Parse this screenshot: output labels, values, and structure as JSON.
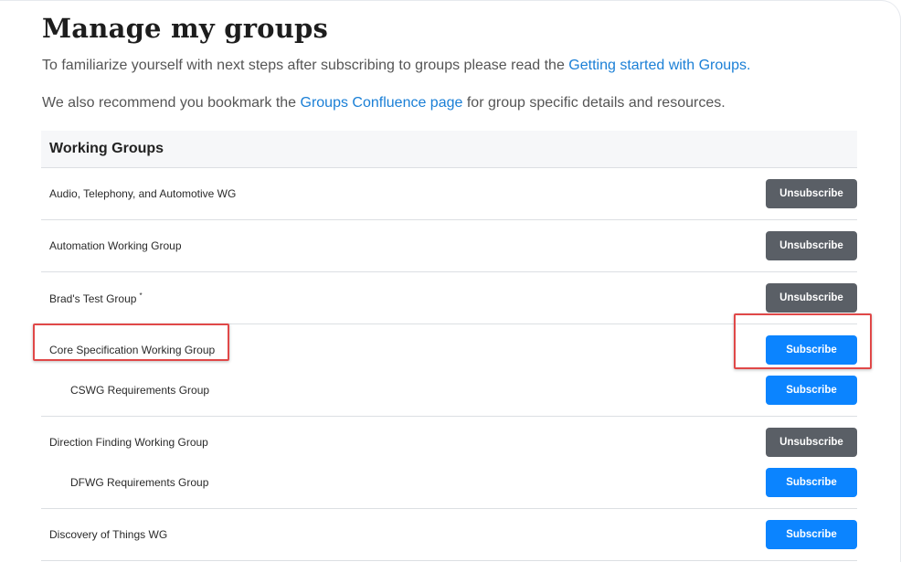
{
  "page": {
    "title": "Manage my groups",
    "intro1": {
      "text": "To familiarize yourself with next steps after subscribing to groups please read the ",
      "link": "Getting started with Groups."
    },
    "intro2": {
      "text_before": "We also recommend you bookmark the ",
      "link": "Groups Confluence page",
      "text_after": " for group specific details and resources."
    }
  },
  "table": {
    "header": "Working Groups",
    "groups": [
      {
        "rows": [
          {
            "name": "Audio, Telephony, and Automotive WG",
            "action": "Unsubscribe"
          }
        ]
      },
      {
        "rows": [
          {
            "name": "Automation Working Group",
            "action": "Unsubscribe"
          }
        ]
      },
      {
        "rows": [
          {
            "name": "Brad's Test Group",
            "marker": "*",
            "action": "Unsubscribe"
          }
        ]
      },
      {
        "rows": [
          {
            "name": "Core Specification Working Group",
            "action": "Subscribe"
          },
          {
            "name": "CSWG Requirements Group",
            "action": "Subscribe"
          }
        ]
      },
      {
        "rows": [
          {
            "name": "Direction Finding Working Group",
            "action": "Unsubscribe"
          },
          {
            "name": "DFWG Requirements Group",
            "action": "Subscribe"
          }
        ]
      },
      {
        "rows": [
          {
            "name": "Discovery of Things WG",
            "action": "Subscribe"
          }
        ]
      }
    ]
  },
  "colors": {
    "link": "#1a7fd6",
    "unsubscribe_button": "#5a5f66",
    "subscribe_button": "#0b84ff",
    "highlight_box": "#e04848"
  }
}
